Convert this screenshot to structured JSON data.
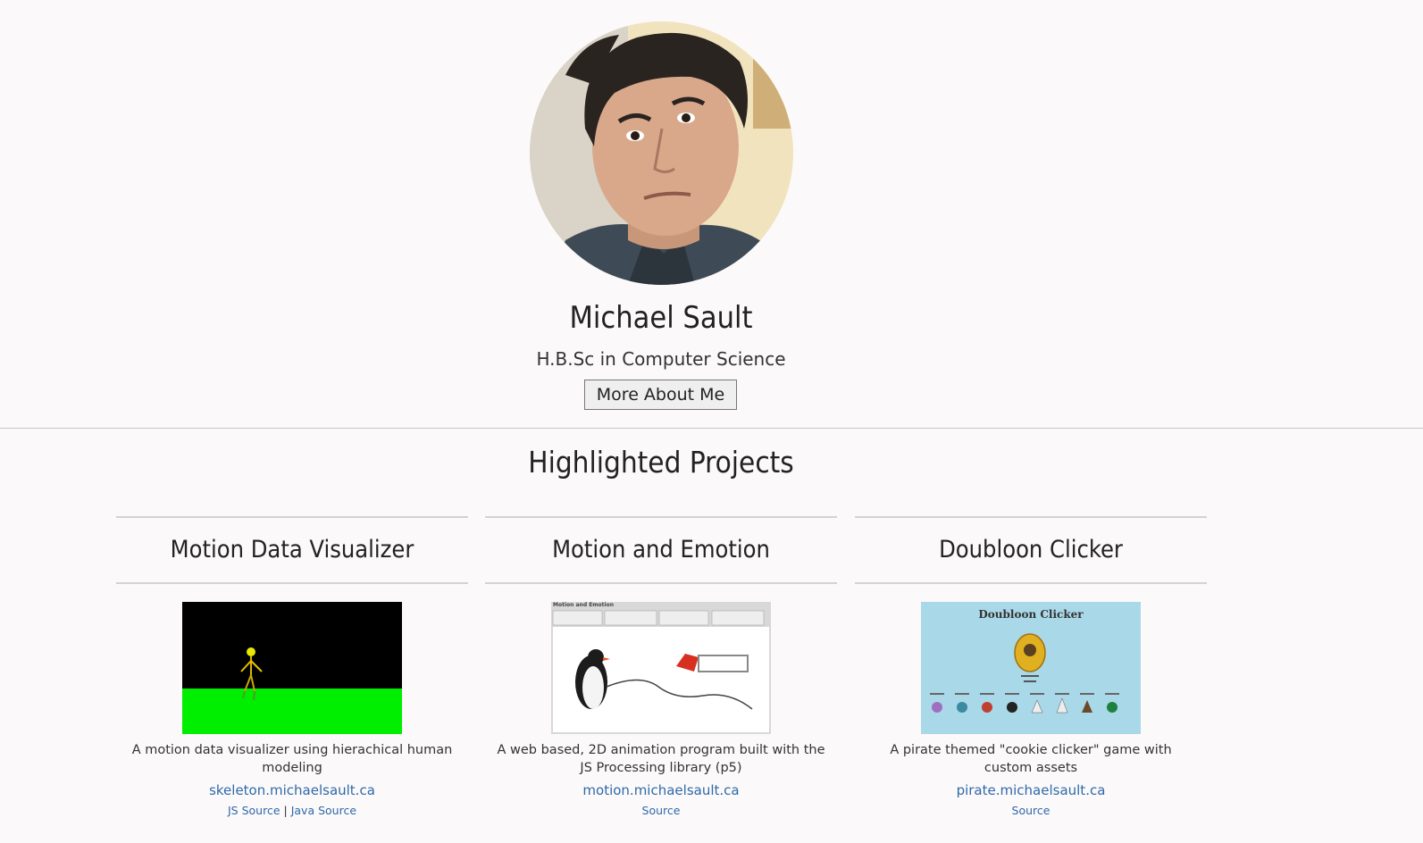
{
  "profile": {
    "name": "Michael Sault",
    "degree": "H.B.Sc in Computer Science",
    "about_button": "More About Me"
  },
  "projects_section": {
    "title": "Highlighted Projects"
  },
  "projects": [
    {
      "title": "Motion Data Visualizer",
      "description": "A motion data visualizer using hierachical human modeling",
      "link": "skeleton.michaelsault.ca",
      "sources": [
        "JS Source",
        "Java Source"
      ],
      "separator": "|"
    },
    {
      "title": "Motion and Emotion",
      "description": "A web based, 2D animation program built with the JS Processing library (p5)",
      "link": "motion.michaelsault.ca",
      "sources": [
        "Source"
      ],
      "thumb_title": "Motion and Emotion"
    },
    {
      "title": "Doubloon Clicker",
      "description": "A pirate themed \"cookie clicker\" game with custom assets",
      "link": "pirate.michaelsault.ca",
      "sources": [
        "Source"
      ],
      "thumb_title": "Doubloon Clicker"
    }
  ],
  "colors": {
    "background": "#fbf9fa",
    "link": "#2f69a8",
    "divider": "#c8c8c8"
  }
}
